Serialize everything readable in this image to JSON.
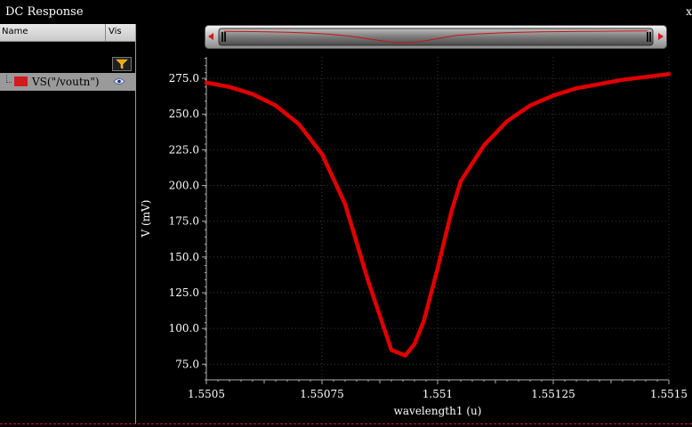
{
  "window": {
    "title": "DC Response",
    "close_glyph": "x"
  },
  "browser": {
    "columns": {
      "name": "Name",
      "vis": "Vis"
    },
    "filter_icon": "filter-funnel-icon",
    "traces": [
      {
        "label": "VS(\"/voutn\")",
        "color": "#d21c1c",
        "visible_icon": "eye-icon"
      }
    ]
  },
  "colors": {
    "trace": "#e00000",
    "background": "#000000",
    "grid": "#3a3a3a",
    "axis": "#b0b0b0"
  },
  "chart_data": {
    "type": "line",
    "xlabel": "wavelength1 (u)",
    "ylabel": "V (mV)",
    "xlim": [
      1.5505,
      1.5515
    ],
    "ylim": [
      64,
      290
    ],
    "x_ticks": [
      1.5505,
      1.55075,
      1.551,
      1.55125,
      1.5515
    ],
    "x_tick_labels": [
      "1.5505",
      "1.55075",
      "1.551",
      "1.55125",
      "1.5515"
    ],
    "y_ticks": [
      75,
      100,
      125,
      150,
      175,
      200,
      225,
      250,
      275
    ],
    "y_tick_labels": [
      "75.0",
      "100.0",
      "125.0",
      "150.0",
      "175.0",
      "200.0",
      "225.0",
      "250.0",
      "275.0"
    ],
    "grid": true,
    "series": [
      {
        "name": "VS(\"/voutn\")",
        "x": [
          1.5505,
          1.55055,
          1.5506,
          1.55065,
          1.5507,
          1.55075,
          1.5508,
          1.55085,
          1.5509,
          1.55093,
          1.55095,
          1.55097,
          1.551,
          1.55103,
          1.55105,
          1.5511,
          1.55115,
          1.5512,
          1.55125,
          1.5513,
          1.55135,
          1.5514,
          1.55145,
          1.5515
        ],
        "y": [
          272,
          269,
          264,
          256,
          243,
          222,
          187,
          133,
          85,
          81,
          89,
          105,
          142,
          182,
          203,
          228,
          245,
          256,
          263,
          268,
          271,
          274,
          276,
          278
        ]
      }
    ]
  }
}
